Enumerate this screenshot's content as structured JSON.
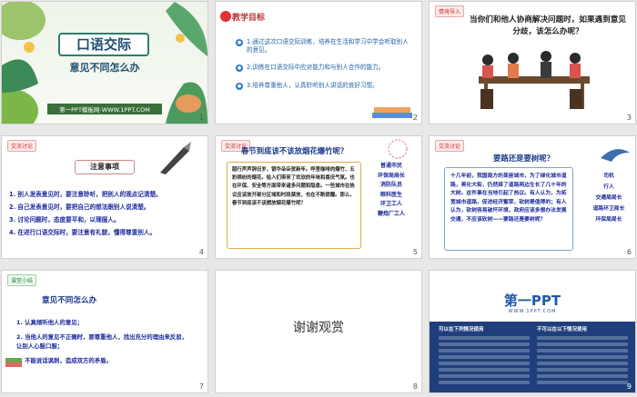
{
  "slides": [
    {
      "num": "1",
      "title": "口语交际",
      "subtitle": "意见不同怎么办",
      "footer": "第一PPT模板网-WWW.1PPT.COM"
    },
    {
      "num": "2",
      "tag": "教学目标",
      "items": [
        "1.通过这次口语交际训练，培养在生活和学习中学会听取别人的意见。",
        "2.训练在口语交际中应对能力和与别人合作的能力。",
        "3.培养尊重他人，认真聆听别人讲话的良好习惯。"
      ]
    },
    {
      "num": "3",
      "tag": "情境导入",
      "question": "当你们和他人协商解决问题时，如果遇到意见分歧，该怎么办呢？"
    },
    {
      "num": "4",
      "tag": "交流讨论",
      "head": "注意事项",
      "items": [
        "1. 别人发表意见时，要注意聆听，把别人的观点记清楚。",
        "2. 自己发表意见时，要把自己的想法跟别人说清楚。",
        "3. 讨论问题时，态度要平和，以理服人。",
        "4. 在进行口语交际时，要注意有礼貌，懂得尊重别人。"
      ]
    },
    {
      "num": "5",
      "tag": "交流讨论",
      "title": "春节到底该不该放烟花爆竹呢？",
      "text": "腊行声声辞旧岁，银华朵朵贺新年。呼里咖啡的爆竹、五彩缤纷的烟花。给人们带来了欢欣的年味和喜庆气氛。也在环保、安全等方面带来诸多问题和隐患。一些城市在热议应该放开部分区域和时段禁放，也在不断提醒。那么，春节到底该不该燃放烟花爆竹呢？",
      "roles": [
        "普通市民",
        "环保局局长",
        "消防队员",
        "眼科医生",
        "环卫工人",
        "鞭炮厂工人"
      ]
    },
    {
      "num": "6",
      "tag": "交流讨论",
      "title": "要路还是要树呢？",
      "text": "十几年前，我国南方的某座城市，为了绿化城市道路，美化大街，仍然择了道路两边生长了几十年的大树。这件事在当地引起了热议。有人认为，为拓宽城市道路，促进经济繁荣，砍树是值得的；有人认为，砍树容易破坏环境，政府应该多想办法发展交通，不应该砍树——要路还是要树呢？",
      "roles": [
        "司机",
        "行人",
        "交通局局长",
        "道路环卫局长",
        "环保局局长"
      ]
    },
    {
      "num": "7",
      "tag": "课堂小结",
      "head": "意见不同怎么办",
      "items": [
        "1. 认真倾听他人的意见；",
        "2. 当他人的意见不正确时，要尊重他人，找出充分的理由来反驳，让别人心服口服；",
        "3. 不能说话讽刺，造成双方的矛盾。"
      ]
    },
    {
      "num": "8",
      "thanks": "谢谢观赏"
    },
    {
      "num": "9",
      "logo": "第一PPT",
      "url": "WWW.1PPT.COM",
      "left_head": "可以在下列情况使用",
      "right_head": "不可以在以下情况使用"
    }
  ]
}
